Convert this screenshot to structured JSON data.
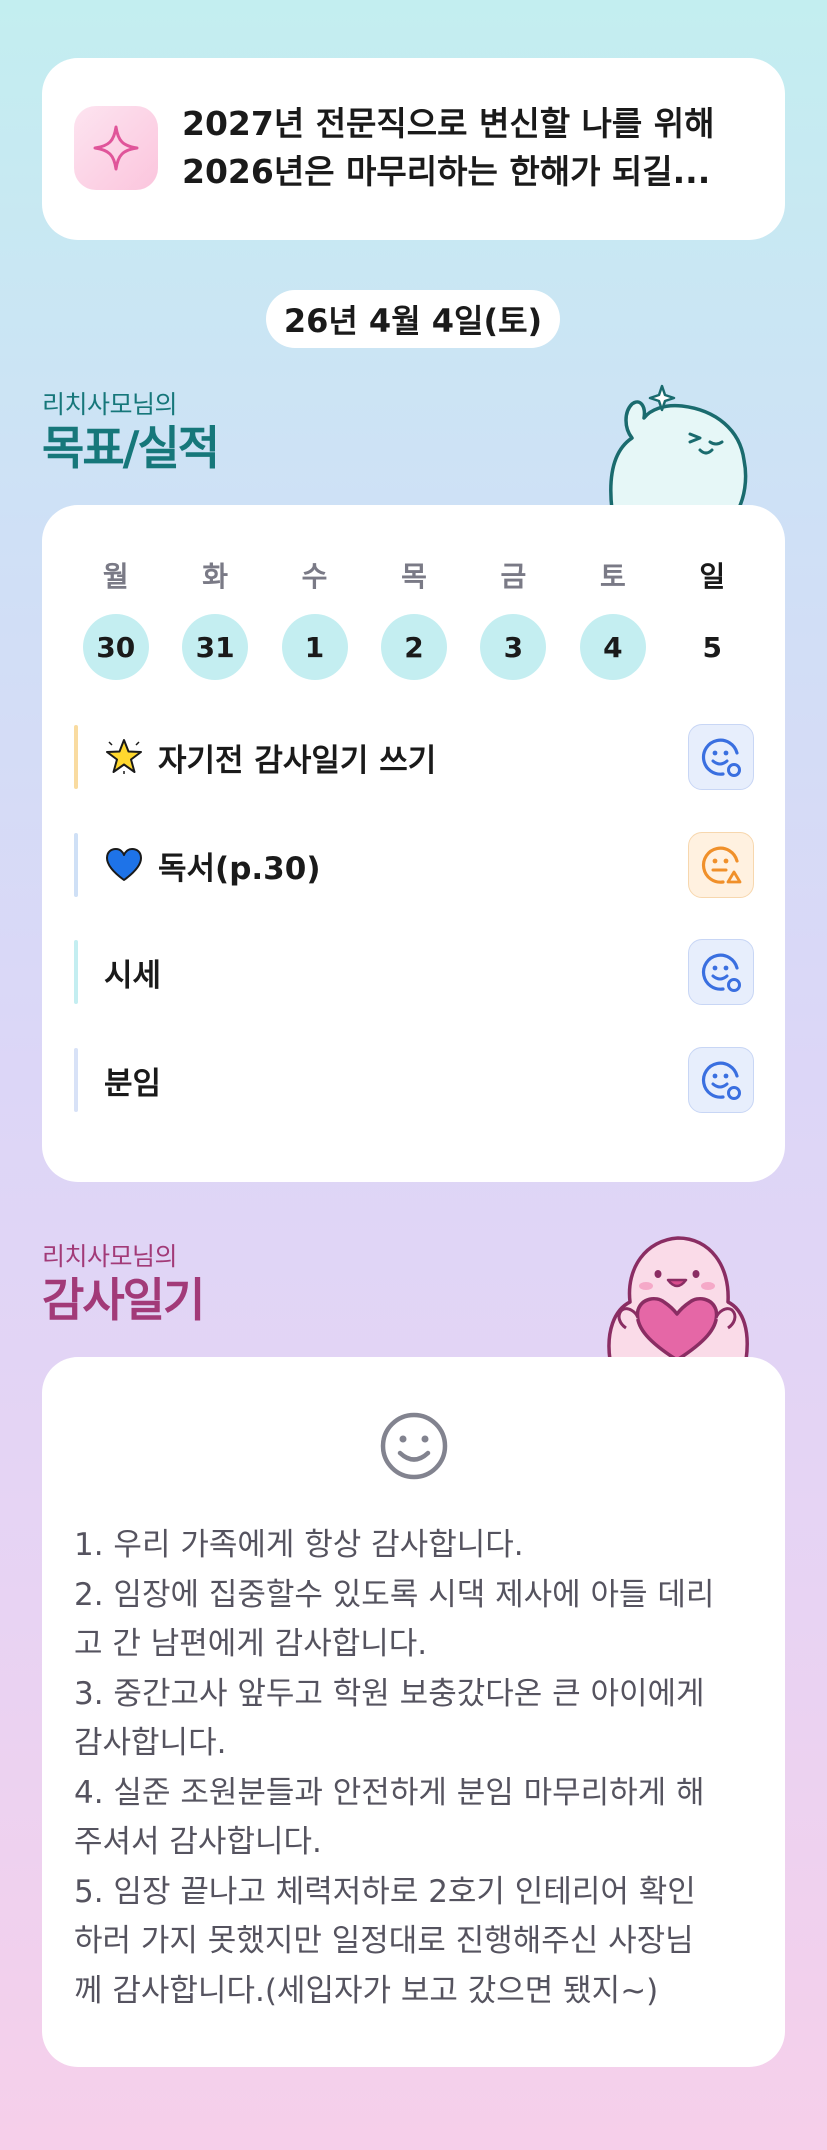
{
  "goal_card": {
    "icon": "sparkle-icon",
    "line1": "2027년 전문직으로 변신할 나를 위해",
    "line2": "2026년은 마무리하는 한해가 되길..."
  },
  "date": "26년 4월 4일(토)",
  "goals_section": {
    "subtitle": "리치사모님의",
    "title": "목표/실적",
    "mascot": "teal-ghost-mascot"
  },
  "week": {
    "weekdays": [
      "월",
      "화",
      "수",
      "목",
      "금",
      "토",
      "일"
    ],
    "days": [
      "30",
      "31",
      "1",
      "2",
      "3",
      "4",
      "5"
    ],
    "completed": [
      true,
      true,
      true,
      true,
      true,
      true,
      false
    ]
  },
  "tasks": [
    {
      "emoji": "star-icon",
      "label": "자기전 감사일기 쓰기",
      "bar_color": "#f9dba0",
      "status_icon": "smile-check-icon",
      "status_color": "blue"
    },
    {
      "emoji": "heart-icon",
      "label": "독서(p.30)",
      "bar_color": "#cfe0f6",
      "status_icon": "neutral-warning-icon",
      "status_color": "orange"
    },
    {
      "emoji": "",
      "label": "시세",
      "bar_color": "#c4eef1",
      "status_icon": "smile-check-icon",
      "status_color": "blue"
    },
    {
      "emoji": "",
      "label": "분임",
      "bar_color": "#d8e2f7",
      "status_icon": "smile-check-icon",
      "status_color": "blue"
    }
  ],
  "diary_section": {
    "subtitle": "리치사모님의",
    "title": "감사일기",
    "mascot": "pink-heart-mascot",
    "face_icon": "smile-icon",
    "lines": [
      "1. 우리 가족에게 항상 감사합니다.",
      "2. 임장에 집중할수 있도록 시댁 제사에 아들 데리",
      "고 간 남편에게 감사합니다.",
      "3. 중간고사 앞두고 학원 보충갔다온 큰 아이에게",
      "감사합니다.",
      "4. 실준 조원분들과 안전하게 분임 마무리하게 해",
      "주셔서 감사합니다.",
      "5. 임장 끝나고 체력저하로 2호기 인테리어 확인",
      "하러 가지 못했지만 일정대로 진행해주신 사장님",
      "께 감사합니다.(세입자가 보고 갔으면 됐지~)"
    ]
  },
  "colors": {
    "teal_accent": "#16777a",
    "pink_accent": "#a23a78",
    "day_done": "#c4eef1",
    "face_blue": "#3a6fe0",
    "face_orange": "#f0902a"
  }
}
